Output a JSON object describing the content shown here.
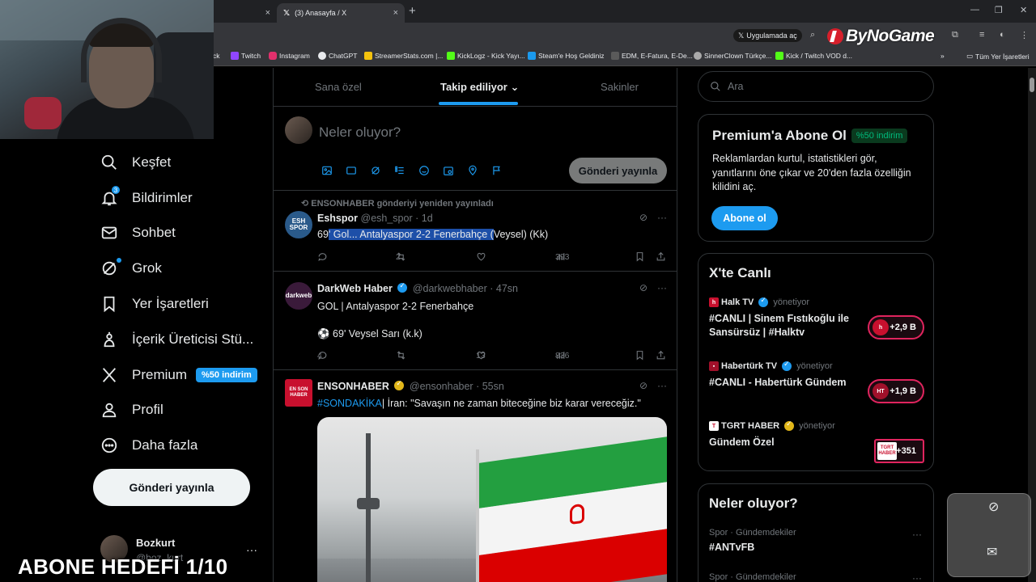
{
  "browser": {
    "tabs": [
      {
        "label": "",
        "active": false
      },
      {
        "label": "(3) Anasayfa / X",
        "active": true
      }
    ],
    "app_button_label": "Uygulamada aç",
    "brand_label": "ByNoGame",
    "bookmarks": [
      {
        "label": "ck",
        "color": "#999999"
      },
      {
        "label": "Twitch",
        "color": "#9146ff"
      },
      {
        "label": "Instagram",
        "color": "#e1306c"
      },
      {
        "label": "ChatGPT",
        "color": "#e8eaed"
      },
      {
        "label": "StreamerStats.com |...",
        "color": "#f4c20d"
      },
      {
        "label": "KickLogz - Kick Yayı...",
        "color": "#53fc18"
      },
      {
        "label": "Steam'e Hoş Geldiniz",
        "color": "#1b9aee"
      },
      {
        "label": "EDM, E-Fatura, E-De...",
        "color": "#5a5a5a"
      },
      {
        "label": "SinnerClown Türkçe...",
        "color": "#aaaaaa"
      },
      {
        "label": "Kick / Twitch VOD d...",
        "color": "#53fc18"
      }
    ],
    "all_bookmarks_label": "Tüm Yer İşaretleri"
  },
  "nav": {
    "items": [
      {
        "label": "Keşfet",
        "icon": "search-icon"
      },
      {
        "label": "Bildirimler",
        "icon": "bell-icon",
        "badge": "3"
      },
      {
        "label": "Sohbet",
        "icon": "mail-icon"
      },
      {
        "label": "Grok",
        "icon": "grok-icon"
      },
      {
        "label": "Yer İşaretleri",
        "icon": "bookmark-icon"
      },
      {
        "label": "İçerik Üreticisi Stü...",
        "icon": "creator-icon"
      },
      {
        "label": "Premium",
        "icon": "x-logo-icon"
      },
      {
        "label": "Profil",
        "icon": "person-icon"
      },
      {
        "label": "Daha fazla",
        "icon": "more-circle-icon"
      }
    ],
    "premium_pill": "%50 indirim",
    "post_button": "Gönderi yayınla",
    "profile_name": "Bozkurt",
    "profile_handle": "@boz_kurt",
    "more": "···"
  },
  "overlay_text": "ABONE HEDEFİ 1/10",
  "feed": {
    "tabs": [
      {
        "label": "Sana özel"
      },
      {
        "label": "Takip ediliyor",
        "chevron": "⌄"
      },
      {
        "label": "Sakinler"
      }
    ],
    "compose_placeholder": "Neler oluyor?",
    "compose_button": "Gönderi yayınla",
    "tweets": [
      {
        "repost_label": "ENSONHABER gönderiyi yeniden yayınladı",
        "name": "Eshspor",
        "handle": "@esh_spor",
        "time": "· 1d",
        "avatar_text": "ESH SPOR",
        "text_prefix": "69",
        "text_highlight": "' Gol... Antalyaspor 2-2 Fenerbahçe (",
        "text_suffix": "Veysel) (Kk)",
        "reposts": "2",
        "views": "393"
      },
      {
        "name": "DarkWeb Haber",
        "handle": "@darkwebhaber",
        "time": "· 47sn",
        "avatar_text": "darkweb",
        "line1": "GOL | Antalyaspor 2-2 Fenerbahçe",
        "line2": "⚽ 69' Veysel Sarı (k.k)",
        "replies": "4",
        "likes": "13",
        "views": "836"
      },
      {
        "name": "ENSONHABER",
        "handle": "@ensonhaber",
        "time": "· 55sn",
        "avatar_text": "EN SON HABER",
        "hashtag": "#SONDAKİKA",
        "text": "| İran: \"Savaşın ne zaman biteceğine biz karar vereceğiz.\""
      }
    ]
  },
  "sidebar": {
    "search_placeholder": "Ara",
    "premium": {
      "title": "Premium'a Abone Ol",
      "pill": "%50 indirim",
      "desc": "Reklamlardan kurtul, istatistikleri gör, yanıtlarını öne çıkar ve 20'den fazla özelliğin kilidini aç.",
      "button": "Abone ol"
    },
    "live": {
      "title": "X'te Canlı",
      "items": [
        {
          "source": "Halk TV",
          "role": "yönetiyor",
          "title": "#CANLI | Sinem Fıstıkoğlu ile Sansürsüz | #Halktv",
          "count": "+2,9 B",
          "logo": "h",
          "color": "#c8102e"
        },
        {
          "source": "Habertürk TV",
          "role": "yönetiyor",
          "title": "#CANLI - Habertürk Gündem",
          "count": "+1,9 B",
          "logo": "HT",
          "color": "#a0102a"
        },
        {
          "source": "TGRT HABER",
          "role": "yönetiyor",
          "title": "Gündem Özel",
          "count": "+351",
          "logo": "TGRT HABER",
          "color": "#c8102e"
        }
      ]
    },
    "trends": {
      "title": "Neler oluyor?",
      "items": [
        {
          "meta": "Spor · Gündemdekiler",
          "name": "#ANTvFB"
        },
        {
          "meta": "Spor · Gündemdekiler",
          "name": ""
        }
      ]
    }
  }
}
